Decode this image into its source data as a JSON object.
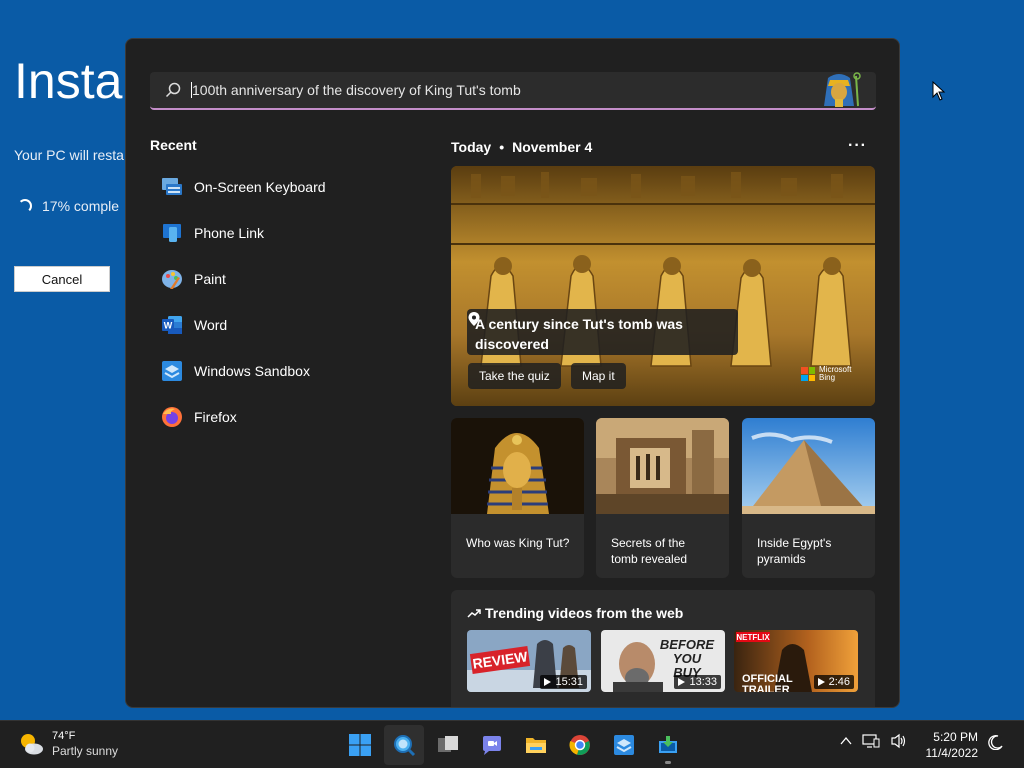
{
  "installer": {
    "title": "Instal",
    "subtitle": "Your PC will resta",
    "progress": "17% comple",
    "cancel_label": "Cancel"
  },
  "search": {
    "query": "100th anniversary of the discovery of King Tut's tomb"
  },
  "recent": {
    "title": "Recent",
    "items": [
      {
        "label": "On-Screen Keyboard",
        "icon": "keyboard-icon"
      },
      {
        "label": "Phone Link",
        "icon": "phone-link-icon"
      },
      {
        "label": "Paint",
        "icon": "paint-icon"
      },
      {
        "label": "Word",
        "icon": "word-icon"
      },
      {
        "label": "Windows Sandbox",
        "icon": "sandbox-icon"
      },
      {
        "label": "Firefox",
        "icon": "firefox-icon"
      }
    ]
  },
  "today": {
    "label": "Today",
    "date": "November 4",
    "more": "···"
  },
  "hero": {
    "title": "A century since Tut's tomb was discovered",
    "quiz_label": "Take the quiz",
    "map_label": "Map it",
    "brand_line1": "Microsoft",
    "brand_line2": "Bing"
  },
  "cards": [
    {
      "label": "Who was King Tut?"
    },
    {
      "label": "Secrets of the tomb revealed"
    },
    {
      "label": "Inside Egypt's pyramids"
    }
  ],
  "trending": {
    "title": "Trending videos from the web",
    "videos": [
      {
        "overlay": "REVIEW",
        "duration": "15:31"
      },
      {
        "overlay": "BEFORE YOU BUY",
        "duration": "13:33"
      },
      {
        "overlay": "OFFICIAL TRAILER",
        "duration": "2:46"
      }
    ]
  },
  "taskbar": {
    "temp": "74°F",
    "condition": "Partly sunny",
    "time": "5:20 PM",
    "date": "11/4/2022"
  },
  "colors": {
    "desktop": "#0a5ba6",
    "flyout": "#202020",
    "accent_underline": "#c48ec9"
  }
}
